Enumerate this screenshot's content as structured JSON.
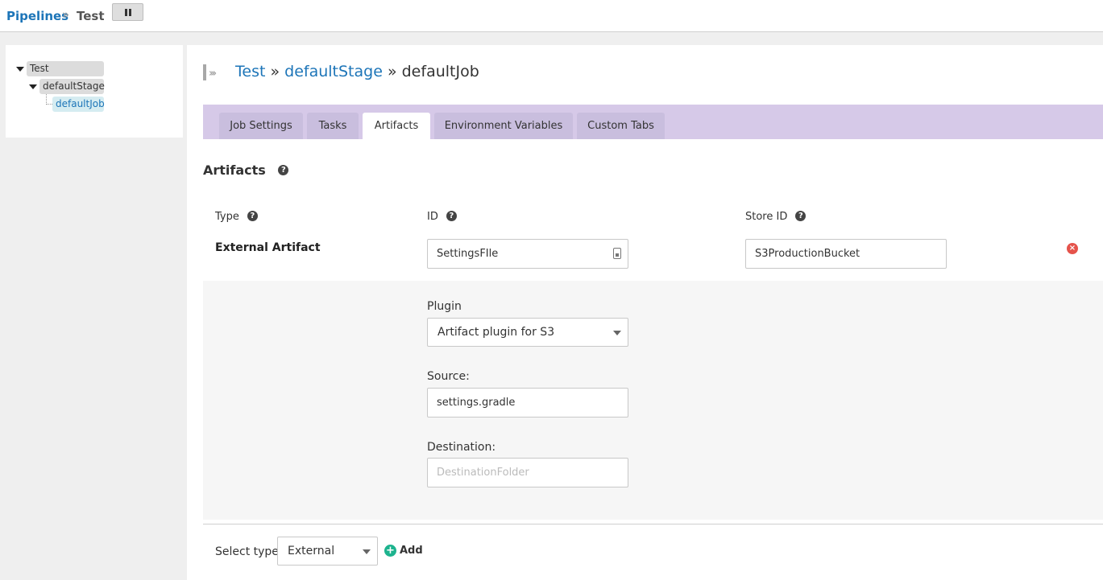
{
  "breadcrumb": {
    "root": "Pipelines",
    "separator": "»",
    "current": "Test"
  },
  "tree": {
    "pipeline": "Test",
    "stage": "defaultStage",
    "job": "defaultJob"
  },
  "header": {
    "pipeline": "Test",
    "sep1": "»",
    "stage": "defaultStage",
    "sep2": "»",
    "job": "defaultJob"
  },
  "tabs": [
    {
      "label": "Job Settings",
      "active": false
    },
    {
      "label": "Tasks",
      "active": false
    },
    {
      "label": "Artifacts",
      "active": true
    },
    {
      "label": "Environment Variables",
      "active": false
    },
    {
      "label": "Custom Tabs",
      "active": false
    }
  ],
  "artifacts": {
    "title": "Artifacts",
    "help": "?",
    "columns": {
      "type": "Type",
      "id": "ID",
      "store_id": "Store ID"
    },
    "row": {
      "type": "External Artifact",
      "id_value": "SettingsFIle",
      "store_id_value": "S3ProductionBucket",
      "remove": "×"
    },
    "plugin": {
      "label": "Plugin",
      "selected": "Artifact plugin for S3"
    },
    "source": {
      "label": "Source:",
      "value": "settings.gradle"
    },
    "destination": {
      "label": "Destination:",
      "placeholder": "DestinationFolder"
    }
  },
  "footer": {
    "select_type_label": "Select type:",
    "selected_type": "External",
    "add_label": "Add",
    "add_icon": "+"
  },
  "colors": {
    "link": "#1d75b8",
    "tab_bar": "#d6c9e8",
    "remove": "#e5534b",
    "add": "#1db38e"
  }
}
